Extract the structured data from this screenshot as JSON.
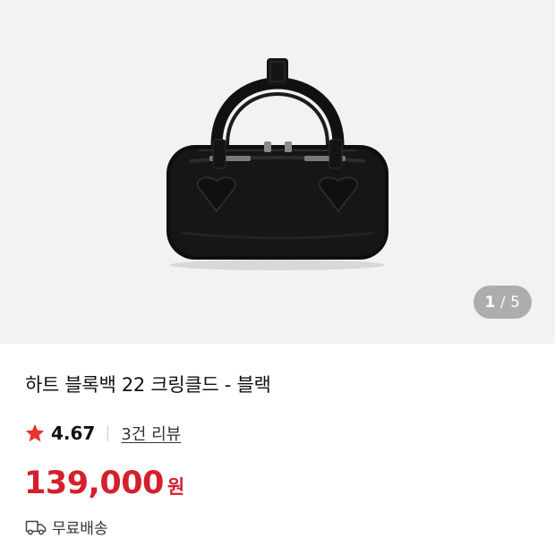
{
  "gallery": {
    "image_alt": "black leather boston handbag",
    "current_page": "1",
    "page_separator": "/",
    "total_pages": "5",
    "background_color": "#f2f2f2"
  },
  "product": {
    "title": "하트 블록백 22 크링클드 - 블랙",
    "rating": "4.67",
    "rating_icon": "star-icon",
    "review_link": "3건 리뷰",
    "price": "139,000",
    "currency": "원",
    "shipping_icon": "truck-icon",
    "shipping": "무료배송"
  },
  "colors": {
    "accent": "#d4202d",
    "star": "#e8342b"
  }
}
